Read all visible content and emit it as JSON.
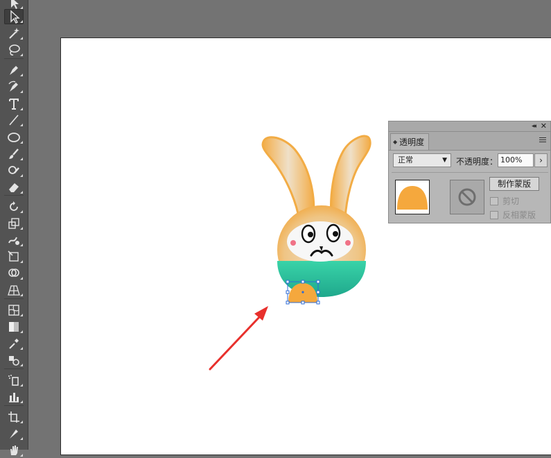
{
  "toolbar": {
    "tools": [
      {
        "id": "selection",
        "icon": "selection-arrow-icon"
      },
      {
        "id": "direct-selection",
        "icon": "direct-selection-icon",
        "active": true
      },
      {
        "id": "magic-wand",
        "icon": "magic-wand-icon"
      },
      {
        "id": "lasso",
        "icon": "lasso-icon"
      },
      {
        "id": "pen",
        "icon": "pen-icon"
      },
      {
        "id": "curvature",
        "icon": "curvature-pen-icon"
      },
      {
        "id": "type",
        "icon": "type-icon"
      },
      {
        "id": "line",
        "icon": "line-segment-icon"
      },
      {
        "id": "ellipse",
        "icon": "ellipse-icon"
      },
      {
        "id": "paintbrush",
        "icon": "paintbrush-icon"
      },
      {
        "id": "shaper",
        "icon": "shaper-icon"
      },
      {
        "id": "eraser",
        "icon": "eraser-icon"
      },
      {
        "id": "rotate",
        "icon": "rotate-icon"
      },
      {
        "id": "scale",
        "icon": "scale-icon"
      },
      {
        "id": "warp",
        "icon": "warp-icon"
      },
      {
        "id": "free-transform",
        "icon": "free-transform-icon"
      },
      {
        "id": "shape-builder",
        "icon": "shape-builder-icon"
      },
      {
        "id": "perspective",
        "icon": "perspective-grid-icon"
      },
      {
        "id": "mesh",
        "icon": "mesh-icon"
      },
      {
        "id": "gradient",
        "icon": "gradient-icon"
      },
      {
        "id": "eyedropper",
        "icon": "eyedropper-icon"
      },
      {
        "id": "blend",
        "icon": "blend-icon"
      },
      {
        "id": "symbol-sprayer",
        "icon": "symbol-sprayer-icon"
      },
      {
        "id": "column-graph",
        "icon": "column-graph-icon"
      },
      {
        "id": "artboard",
        "icon": "artboard-icon"
      },
      {
        "id": "slice",
        "icon": "slice-icon"
      },
      {
        "id": "hand",
        "icon": "hand-icon"
      }
    ]
  },
  "panel": {
    "tab_label": "透明度",
    "blend_mode": "正常",
    "opacity_label": "不透明度：",
    "opacity_value": "100%",
    "make_mask_label": "制作蒙版",
    "clip_label": "剪切",
    "invert_mask_label": "反相蒙版",
    "double_arrow": "◂◂",
    "close": "✕",
    "chevron": "›"
  },
  "colors": {
    "orange": "#f5a83d",
    "teal": "#2bc6a0",
    "arrow": "#e8302c",
    "selection": "#2d6bd6"
  }
}
